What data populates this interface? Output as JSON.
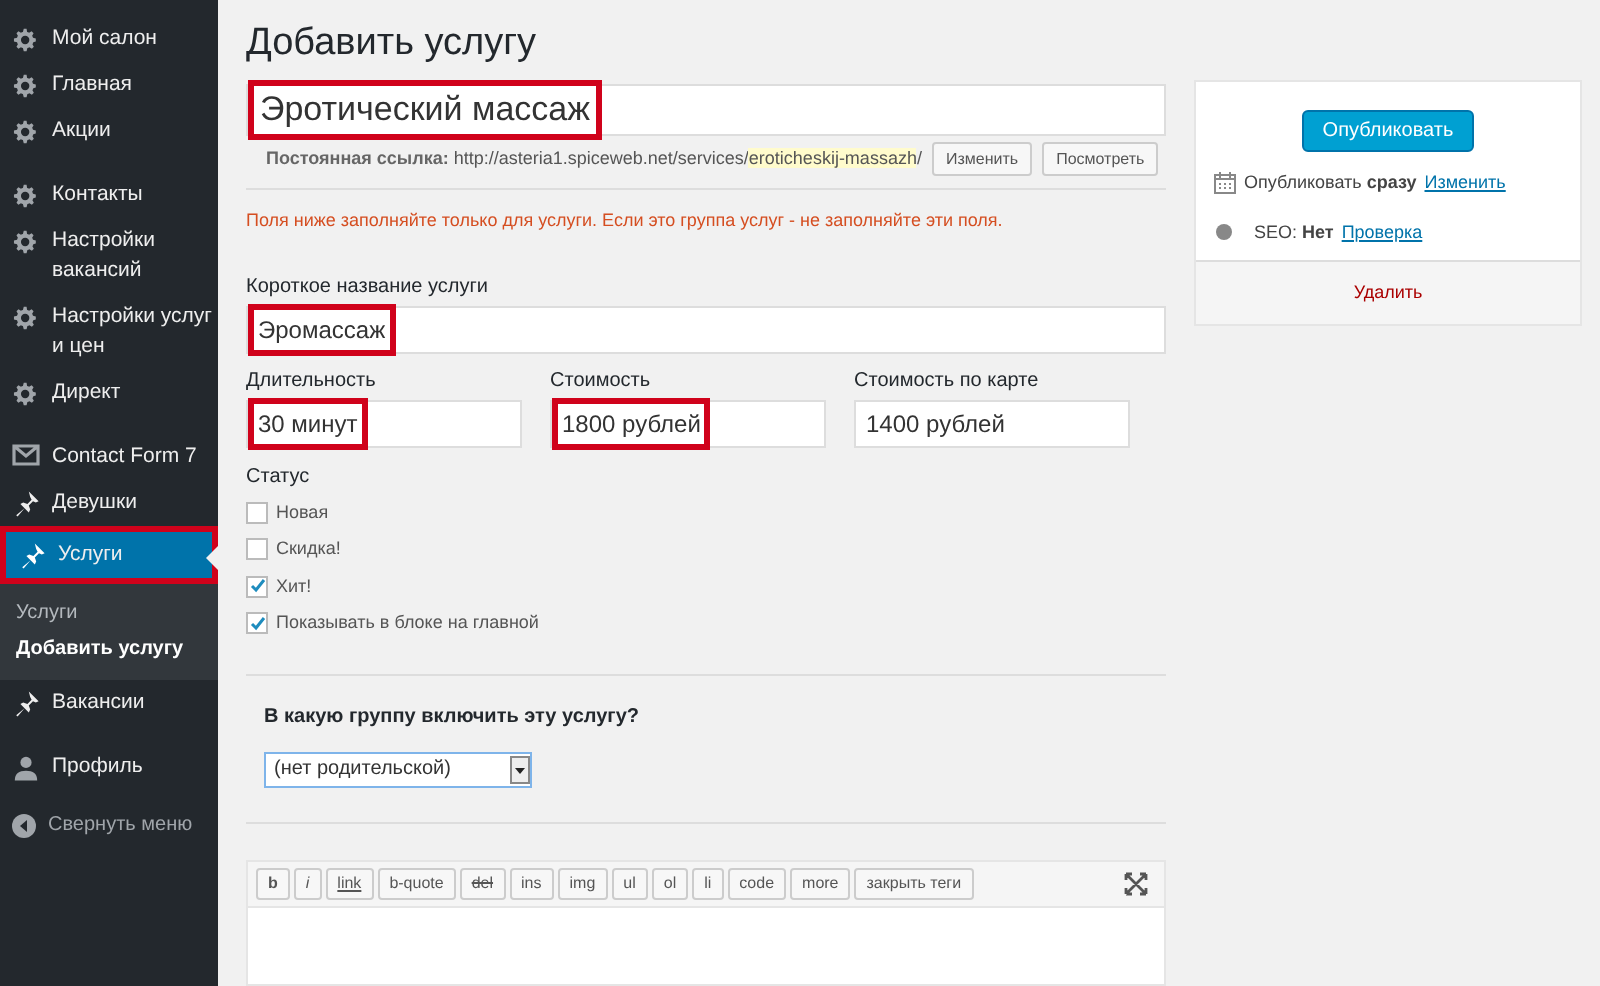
{
  "sidebar": {
    "sections": [
      [
        {
          "label": "Мой салон",
          "kind": "gear",
          "selected": false,
          "highlighted": false
        },
        {
          "label": "Главная",
          "kind": "gear",
          "selected": false,
          "highlighted": false
        },
        {
          "label": "Акции",
          "kind": "gear",
          "selected": false,
          "highlighted": false
        }
      ],
      [
        {
          "label": "Контакты",
          "kind": "gear",
          "selected": false,
          "highlighted": false
        },
        {
          "label": "Настройки вакансий",
          "kind": "gear",
          "selected": false,
          "highlighted": false
        },
        {
          "label": "Настройки услуг и цен",
          "kind": "gear",
          "selected": false,
          "highlighted": false
        },
        {
          "label": "Директ",
          "kind": "gear",
          "selected": false,
          "highlighted": false
        }
      ],
      [
        {
          "label": "Contact Form 7",
          "kind": "mail",
          "selected": false,
          "highlighted": false
        },
        {
          "label": "Девушки",
          "kind": "pin",
          "selected": false,
          "highlighted": false
        },
        {
          "label": "Услуги",
          "kind": "pin",
          "selected": true,
          "highlighted": true,
          "children": [
            {
              "label": "Услуги",
              "selected": false
            },
            {
              "label": "Добавить услугу",
              "selected": true
            }
          ]
        },
        {
          "label": "Вакансии",
          "kind": "pin",
          "selected": false,
          "highlighted": false
        }
      ],
      [
        {
          "label": "Профиль",
          "kind": "user",
          "selected": false,
          "highlighted": false
        }
      ]
    ],
    "collapse": "Свернуть меню"
  },
  "page_title": "Добавить услугу",
  "title_field": {
    "value": "Эротический массаж",
    "highlighted": true
  },
  "permalink": {
    "label": "Постоянная ссылка:",
    "base": "http://asteria1.spiceweb.net/services/",
    "slug": "eroticheskij-massazh",
    "end": "/",
    "buttons": [
      "Изменить",
      "Посмотреть"
    ]
  },
  "notice": "Поля ниже заполняйте только для услуги. Если это группа услуг - не заполняйте эти поля.",
  "short_name": {
    "label": "Короткое название услуги",
    "value": "Эромассаж",
    "highlighted": true
  },
  "fields": [
    {
      "label": "Длительность",
      "value": "30 минут",
      "highlighted": true
    },
    {
      "label": "Стоимость",
      "value": "1800 рублей",
      "highlighted": true
    },
    {
      "label": "Стоимость по карте",
      "value": "1400 рублей",
      "highlighted": false
    }
  ],
  "status": {
    "label": "Статус",
    "options": [
      {
        "label": "Новая",
        "checked": false
      },
      {
        "label": "Скидка!",
        "checked": false
      },
      {
        "label": "Хит!",
        "checked": true
      },
      {
        "label": "Показывать в блоке на главной",
        "checked": true
      }
    ]
  },
  "group": {
    "label": "В какую группу включить эту услугу?",
    "value": "(нет родительской)"
  },
  "editor": {
    "buttons": [
      {
        "label": "b",
        "kind": "bold"
      },
      {
        "label": "i",
        "kind": "italic"
      },
      {
        "label": "link",
        "kind": "link"
      },
      {
        "label": "b-quote",
        "kind": "plain"
      },
      {
        "label": "del",
        "kind": "del"
      },
      {
        "label": "ins",
        "kind": "plain"
      },
      {
        "label": "img",
        "kind": "plain"
      },
      {
        "label": "ul",
        "kind": "plain"
      },
      {
        "label": "ol",
        "kind": "plain"
      },
      {
        "label": "li",
        "kind": "plain"
      },
      {
        "label": "code",
        "kind": "plain"
      },
      {
        "label": "more",
        "kind": "plain"
      },
      {
        "label": "закрыть теги",
        "kind": "plain"
      }
    ]
  },
  "publish": {
    "button": "Опубликовать",
    "schedule_label": "Опубликовать",
    "schedule_value": "сразу",
    "schedule_link": "Изменить",
    "seo_label": "SEO:",
    "seo_value": "Нет",
    "seo_link": "Проверка",
    "delete": "Удалить"
  }
}
